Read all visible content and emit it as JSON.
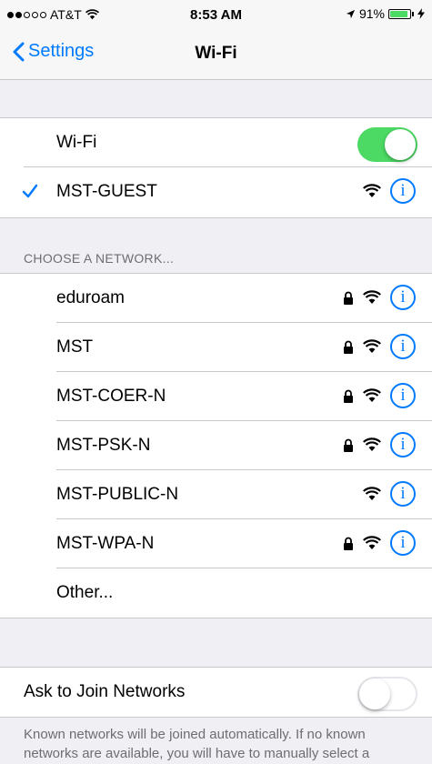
{
  "status": {
    "carrier": "AT&T",
    "signal_bars_filled": 2,
    "signal_bars_total": 5,
    "time": "8:53 AM",
    "battery": "91%",
    "battery_level": 0.91
  },
  "nav": {
    "back_label": "Settings",
    "title": "Wi-Fi"
  },
  "wifi": {
    "label": "Wi-Fi",
    "enabled": true,
    "connected_network": "MST-GUEST"
  },
  "choose_header": "CHOOSE A NETWORK...",
  "networks": [
    {
      "name": "eduroam",
      "locked": true
    },
    {
      "name": "MST",
      "locked": true
    },
    {
      "name": "MST-COER-N",
      "locked": true
    },
    {
      "name": "MST-PSK-N",
      "locked": true
    },
    {
      "name": "MST-PUBLIC-N",
      "locked": false
    },
    {
      "name": "MST-WPA-N",
      "locked": true
    }
  ],
  "other_label": "Other...",
  "ask": {
    "label": "Ask to Join Networks",
    "enabled": false
  },
  "footer": "Known networks will be joined automatically. If no known networks are available, you will have to manually select a",
  "colors": {
    "accent": "#007aff",
    "toggle_on": "#4cd964",
    "background": "#efeff4"
  }
}
